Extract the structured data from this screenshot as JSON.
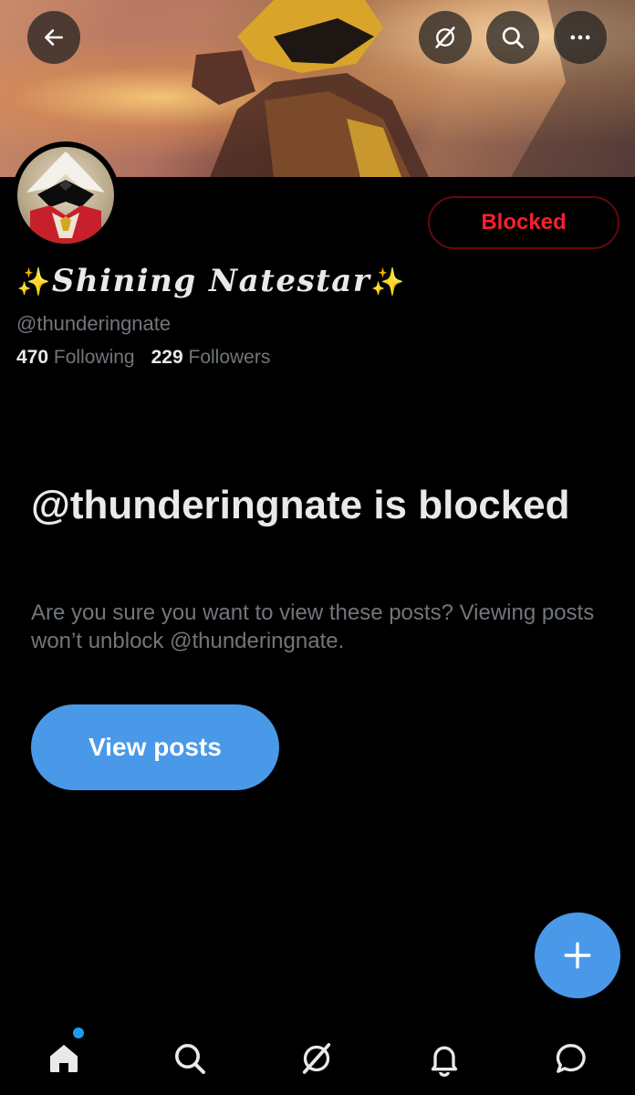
{
  "profile": {
    "blocked_label": "Blocked",
    "name_prefix_emoji": "✨",
    "display_name": "Shining Natestar",
    "name_suffix_emoji": "✨",
    "handle": "@thunderingnate",
    "following_count": "470",
    "following_label": "Following",
    "followers_count": "229",
    "followers_label": "Followers"
  },
  "blocked_notice": {
    "title": "@thunderingnate is blocked",
    "description": "Are you sure you want to view these posts? Viewing posts won’t unblock @thunderingnate.",
    "button_label": "View posts"
  },
  "header": {
    "icons": [
      "back-arrow-icon",
      "grok-icon",
      "search-icon",
      "more-icon"
    ]
  },
  "tabs": [
    "home-icon",
    "search-icon",
    "grok-icon",
    "notifications-icon",
    "messages-icon"
  ],
  "colors": {
    "accent": "#4a99e9",
    "blocked_red": "#f4212e",
    "muted_text": "#71767b",
    "notification_dot": "#1d9bf0"
  }
}
